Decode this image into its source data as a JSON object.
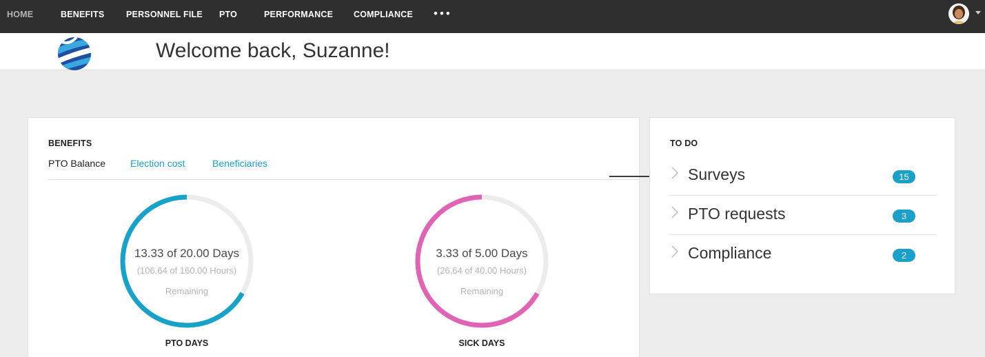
{
  "nav": {
    "items": [
      {
        "label": "HOME"
      },
      {
        "label": "BENEFITS"
      },
      {
        "label": "PERSONNEL FILE"
      },
      {
        "label": "PTO"
      },
      {
        "label": "PERFORMANCE"
      },
      {
        "label": "COMPLIANCE"
      }
    ],
    "more": "•••",
    "icons": {
      "more": "more-dots-icon",
      "avatar": "user-avatar",
      "caret": "caret-down-icon"
    }
  },
  "header": {
    "welcome": "Welcome back, Suzanne!",
    "logo_icon": "globe-logo"
  },
  "benefits": {
    "title": "BENEFITS",
    "tabs": [
      "PTO Balance",
      "Election cost",
      "Beneficiaries"
    ],
    "pto": {
      "main": "13.33 of 20.00 Days",
      "sub": "(106.64 of 160.00 Hours)",
      "remaining": "Remaining",
      "label": "PTO DAYS",
      "fraction": 0.6665,
      "color": "#17a2c9"
    },
    "sick": {
      "main": "3.33 of 5.00 Days",
      "sub": "(26.64 of 40.00 Hours)",
      "remaining": "Remaining",
      "label": "SICK DAYS",
      "fraction": 0.666,
      "color": "#e063b6"
    }
  },
  "todo": {
    "title": "TO DO",
    "items": [
      {
        "label": "Surveys",
        "count": "15"
      },
      {
        "label": "PTO requests",
        "count": "3"
      },
      {
        "label": "Compliance",
        "count": "2"
      }
    ]
  },
  "colors": {
    "accent": "#1aa0c9",
    "nav_bg": "#2f2f2f",
    "track": "#ececec"
  }
}
